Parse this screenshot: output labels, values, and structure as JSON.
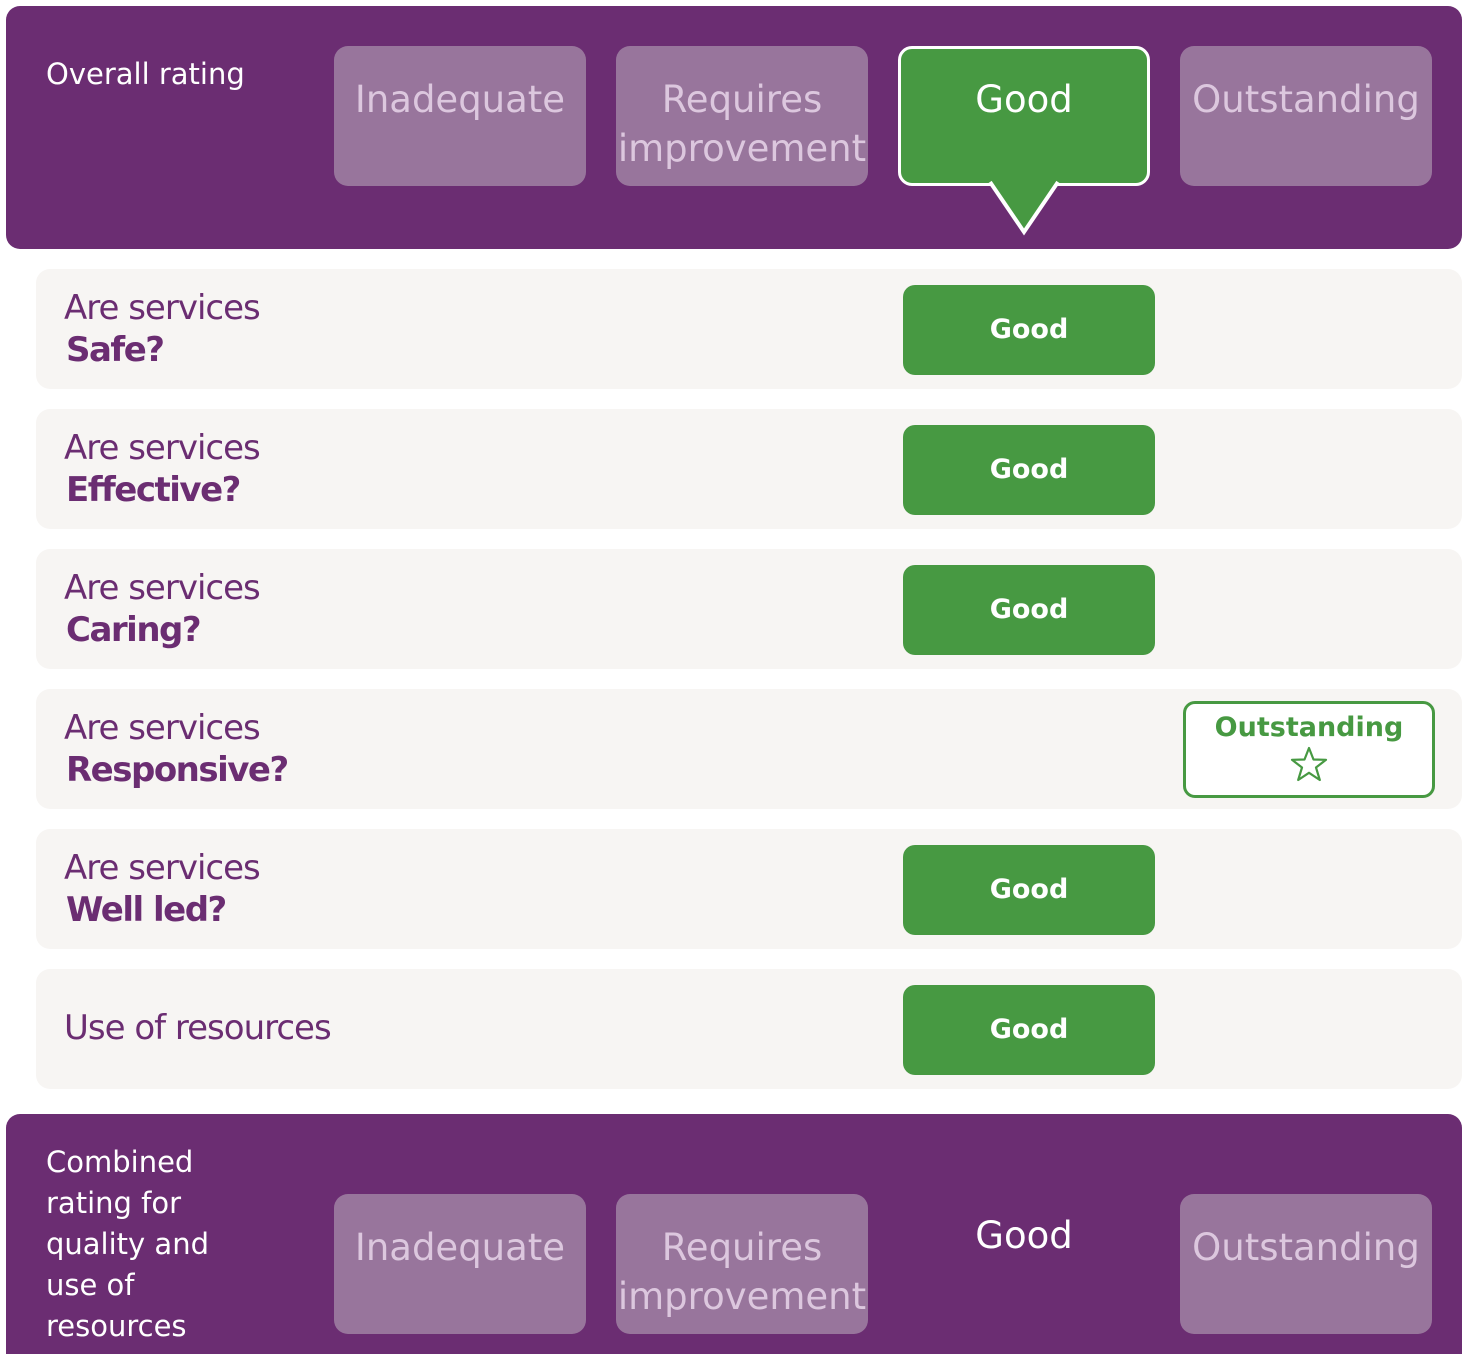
{
  "overall": {
    "label": "Overall rating",
    "scale": [
      "Inadequate",
      "Requires\nimprovement",
      "Good",
      "Outstanding"
    ],
    "selected": "Good"
  },
  "questions": [
    {
      "prefix": "Are services",
      "name": "Safe?",
      "rating": "Good"
    },
    {
      "prefix": "Are services",
      "name": "Effective?",
      "rating": "Good"
    },
    {
      "prefix": "Are services",
      "name": "Caring?",
      "rating": "Good"
    },
    {
      "prefix": "Are services",
      "name": "Responsive?",
      "rating": "Outstanding"
    },
    {
      "prefix": "Are services",
      "name": "Well led?",
      "rating": "Good"
    },
    {
      "name": "Use of resources",
      "rating": "Good"
    }
  ],
  "combined": {
    "label": "Combined\nrating for\nquality and\nuse of\nresources",
    "scale": [
      "Inadequate",
      "Requires\nimprovement",
      "Good",
      "Outstanding"
    ],
    "selected": "Good"
  },
  "colors": {
    "purple": "#6b2d72",
    "muted_purple": "#98759c",
    "green": "#479942",
    "row_background": "#f7f5f3"
  },
  "icons": {
    "outstanding_marker": "star-outline-icon",
    "selected_marker": "pointer-triangle-icon"
  }
}
